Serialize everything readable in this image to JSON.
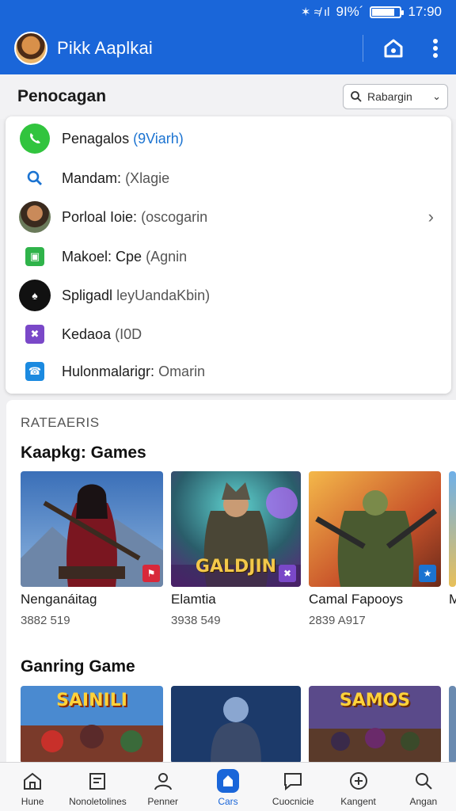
{
  "status_bar": {
    "indicators": "✶ ≉ ıl",
    "battery_text": "9I%´",
    "time": "17:90",
    "battery_level": 0.8
  },
  "app_bar": {
    "title": "Pikk Aaplkai",
    "icons": [
      "avatar",
      "home-icon",
      "more-vert-icon"
    ]
  },
  "section": {
    "title": "Penocagan",
    "dropdown_value": "Rabargin"
  },
  "menu_items": [
    {
      "label": "Penagalos",
      "sub": "(9Viarh)",
      "icon": "phone-icon",
      "accent": true
    },
    {
      "label": "Mandam:",
      "sub": "(Xlagie",
      "icon": "search-icon"
    },
    {
      "label": "Porloal Ioie:",
      "sub": "(oscogarin",
      "icon": "portrait-avatar",
      "has_arrow": true
    },
    {
      "label": "Makoel: Cpe",
      "sub": "(Agnin",
      "icon": "video-icon"
    },
    {
      "label": "Spligadl",
      "sub": "leyUandaKbin)",
      "icon": "spade-logo-icon"
    },
    {
      "label": "Kedaoa",
      "sub": "(I0D",
      "icon": "purple-app-icon"
    },
    {
      "label": "Hulonmalarigr:",
      "sub": "Omarin",
      "icon": "phone-square-icon"
    }
  ],
  "category_label": "RATEAERIS",
  "row1": {
    "title": "Kaapkg: Games",
    "games": [
      {
        "name": "Nenganáitag",
        "meta": "3882 519",
        "badge_color": "#d8283a"
      },
      {
        "name": "Elamtia",
        "meta": "3938 549",
        "thumb_text": "GALDJIN",
        "badge_color": "#7a48c8"
      },
      {
        "name": "Camal Fapooys",
        "meta": "2839 A917",
        "badge_color": "#1b73d1"
      },
      {
        "name": "M",
        "meta": ""
      }
    ]
  },
  "row2": {
    "title": "Ganring Game",
    "banners": [
      {
        "text": "SAINILI"
      },
      {
        "text": ""
      },
      {
        "text": "SAMOS"
      }
    ]
  },
  "bottom_nav": [
    {
      "label": "Hune",
      "icon": "home-outline-icon"
    },
    {
      "label": "Nonoletolines",
      "icon": "notes-icon"
    },
    {
      "label": "Penner",
      "icon": "person-icon"
    },
    {
      "label": "Cars",
      "icon": "active-tab-icon",
      "active": true
    },
    {
      "label": "Cuocnicie",
      "icon": "chat-icon"
    },
    {
      "label": "Kangent",
      "icon": "add-circle-icon"
    },
    {
      "label": "Angan",
      "icon": "search-icon"
    }
  ],
  "colors": {
    "primary": "#1a66d9",
    "accent_text": "#1b73d1",
    "green": "#31c43e"
  }
}
